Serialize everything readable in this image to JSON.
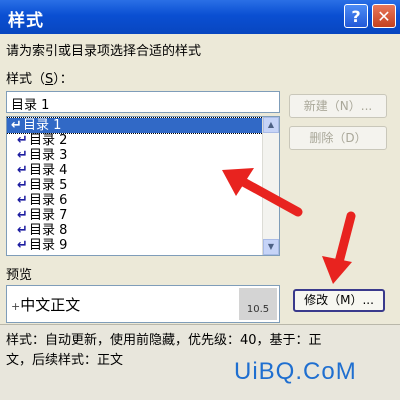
{
  "dialog": {
    "title": "样式",
    "help_label": "?",
    "close_label": "✕",
    "instruction": "请为索引或目录项选择合适的样式",
    "style_label_prefix": "样式（",
    "style_label_key": "S",
    "style_label_suffix": "）：",
    "style_input_value": "目录 1",
    "styles": [
      {
        "arrow": "↵",
        "label": "目录 1"
      },
      {
        "arrow": "↵",
        "label": "目录 2"
      },
      {
        "arrow": "↵",
        "label": "目录 3"
      },
      {
        "arrow": "↵",
        "label": "目录 4"
      },
      {
        "arrow": "↵",
        "label": "目录 5"
      },
      {
        "arrow": "↵",
        "label": "目录 6"
      },
      {
        "arrow": "↵",
        "label": "目录 7"
      },
      {
        "arrow": "↵",
        "label": "目录 8"
      },
      {
        "arrow": "↵",
        "label": "目录 9"
      }
    ],
    "new_button": "新建（N）...",
    "delete_button": "删除（D）",
    "preview_label": "预览",
    "preview_text": "中文正文",
    "preview_mark": "+",
    "preview_size": "10.5",
    "modify_button": "修改（M）...",
    "description_line1": "样式：自动更新，使用前隐藏，优先级：40，基于：正",
    "description_line2": "文，后续样式：正文"
  },
  "watermark": "UiBQ.CoM",
  "colors": {
    "annotation_arrow": "#e8231f",
    "selection": "#3169c6",
    "titlebar": "#0a4fd2"
  }
}
